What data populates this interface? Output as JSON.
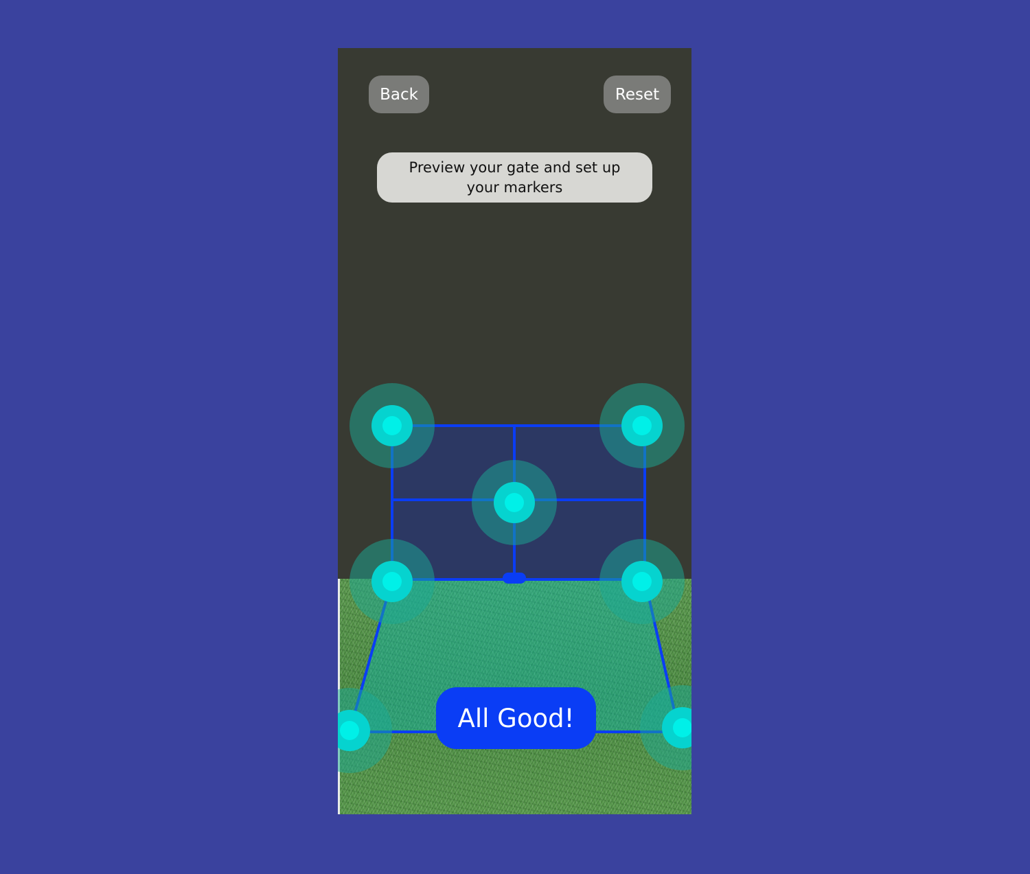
{
  "toolbar": {
    "back_label": "Back",
    "reset_label": "Reset"
  },
  "instruction": {
    "text": "Preview your gate and set up your markers"
  },
  "confirm": {
    "label": "All Good!"
  },
  "colors": {
    "background": "#3a429e",
    "screen": "#383a32",
    "gate_line": "#0a3df5",
    "marker_core": "#00e5e0",
    "button_gray": "#7a7b78",
    "primary_button": "#0a3df5"
  },
  "markers": [
    {
      "name": "gate-top-left-marker"
    },
    {
      "name": "gate-top-right-marker"
    },
    {
      "name": "gate-center-marker"
    },
    {
      "name": "gate-bottom-left-marker"
    },
    {
      "name": "gate-bottom-right-marker"
    },
    {
      "name": "ground-left-marker"
    },
    {
      "name": "ground-right-marker"
    }
  ]
}
